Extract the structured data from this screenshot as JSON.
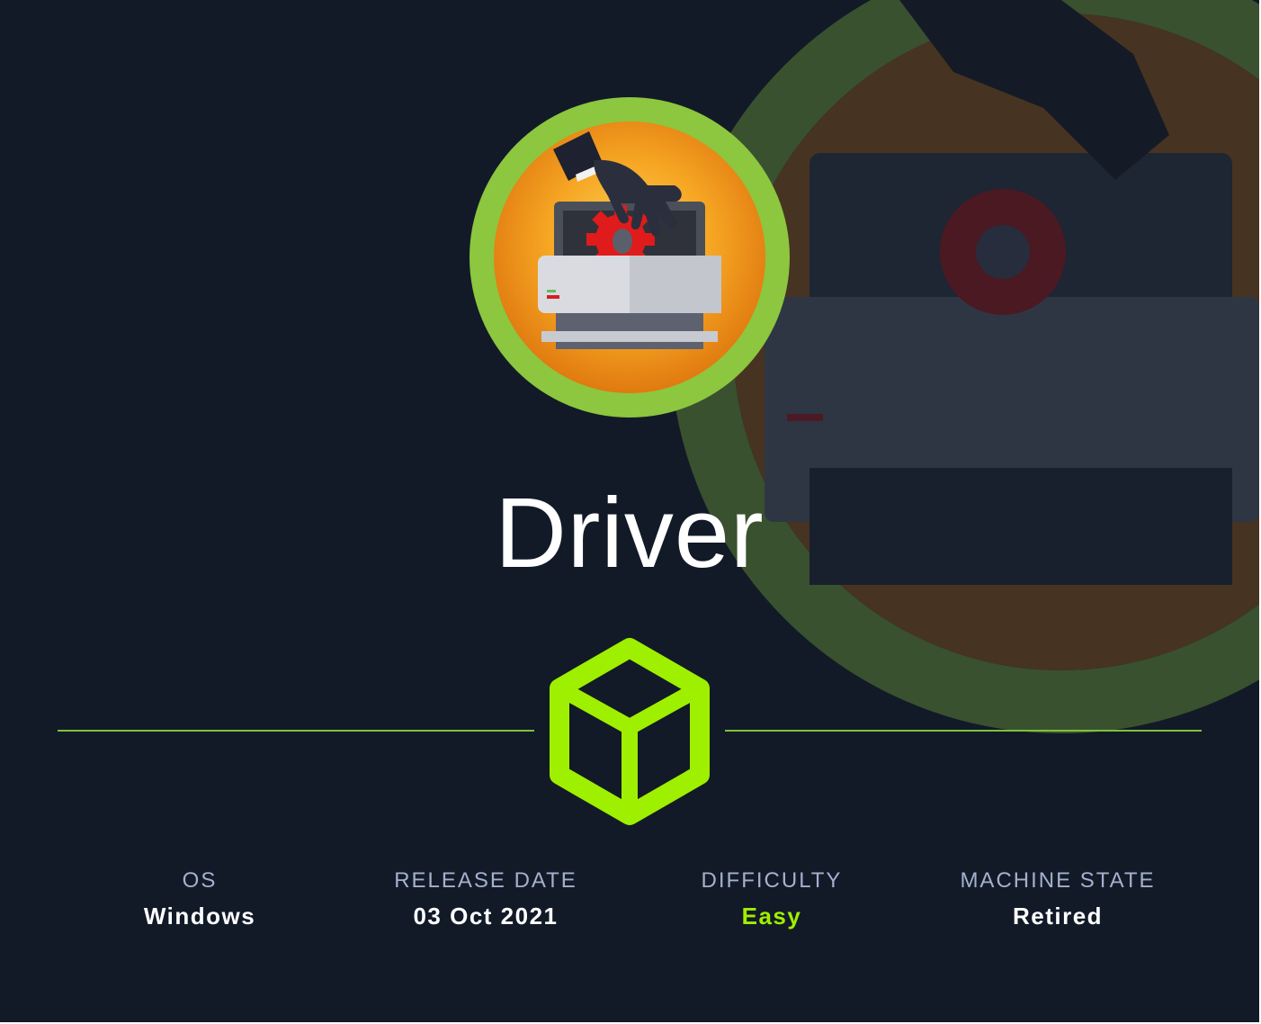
{
  "machine": {
    "name": "Driver",
    "avatar_icon": "printer-gear-hand-icon",
    "badge_icon": "cube-icon"
  },
  "stats": [
    {
      "label": "OS",
      "value": "Windows"
    },
    {
      "label": "RELEASE DATE",
      "value": "03 Oct 2021"
    },
    {
      "label": "DIFFICULTY",
      "value": "Easy"
    },
    {
      "label": "MACHINE STATE",
      "value": "Retired"
    }
  ],
  "colors": {
    "background": "#121a28",
    "accent_green": "#9fef00",
    "ring_green": "#8dc63f",
    "avatar_orange": "#f39a1c",
    "label_grey": "#a4b1cd",
    "divider_green": "#7fc23a"
  }
}
